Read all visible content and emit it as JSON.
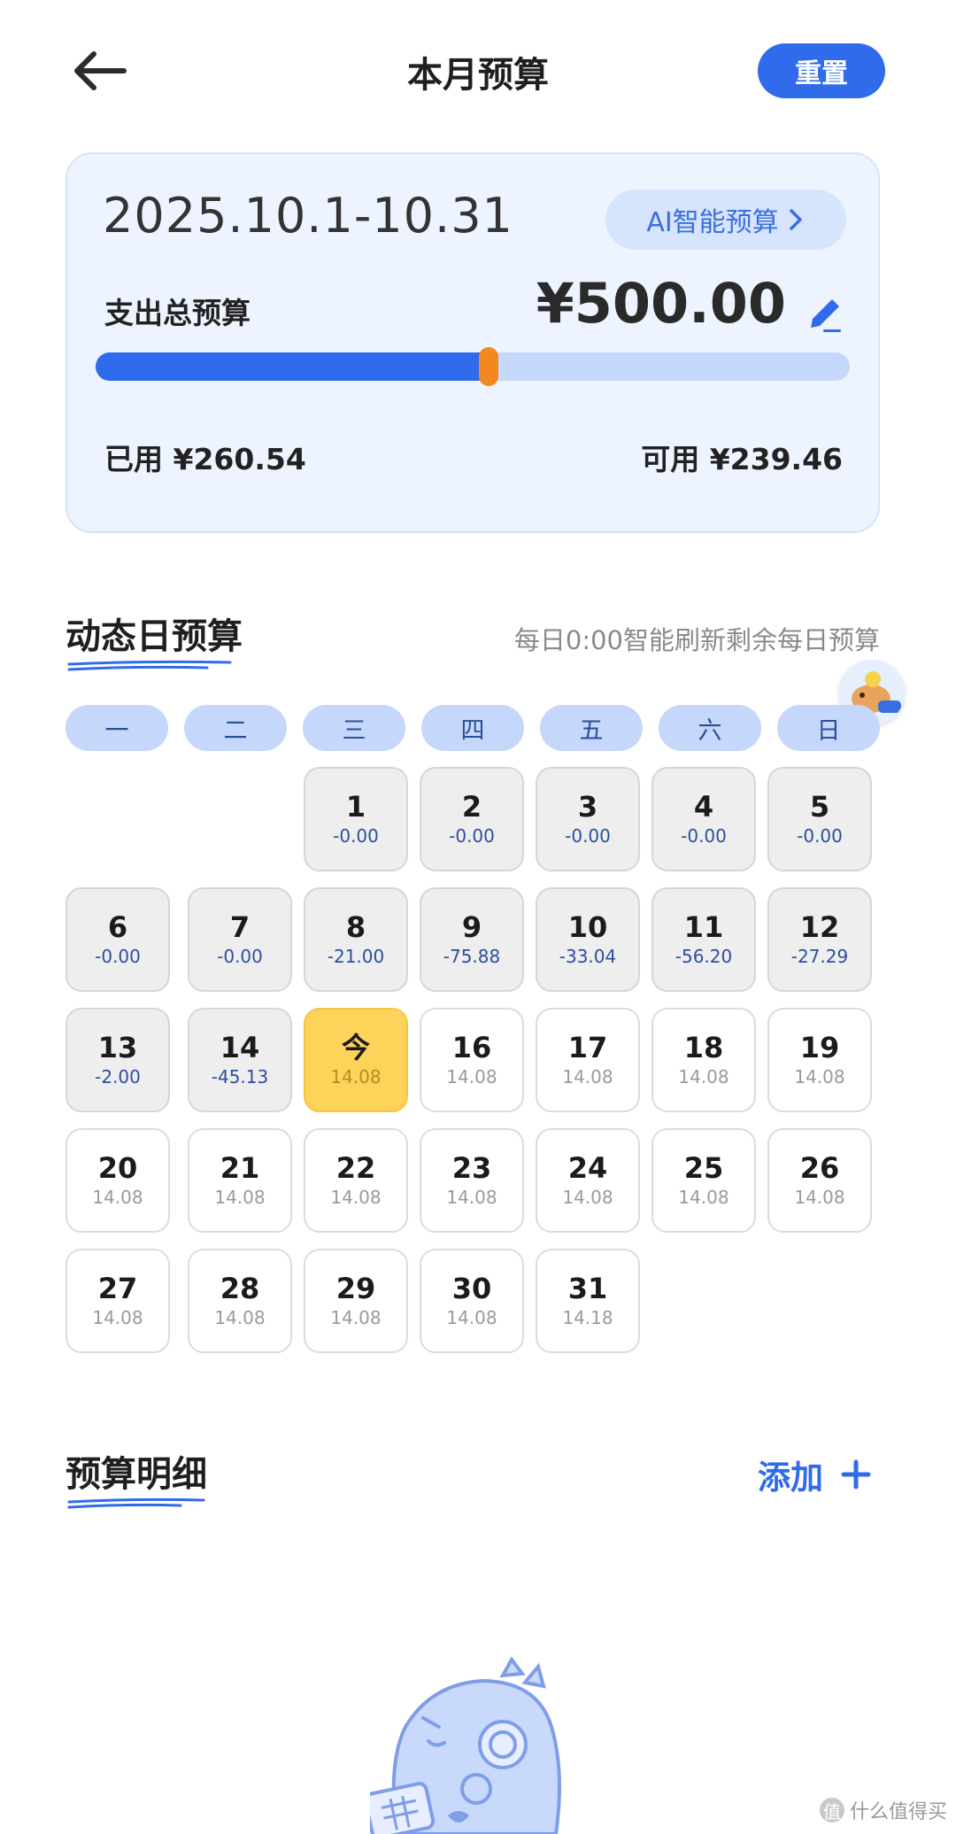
{
  "header": {
    "title": "本月预算",
    "reset_label": "重置"
  },
  "budget": {
    "date_range": "2025.10.1-10.31",
    "ai_button_label": "AI智能预算",
    "total_label": "支出总预算",
    "total_value": "¥500.00",
    "used_text": "已用 ¥260.54",
    "available_text": "可用 ¥239.46",
    "used_fraction": 0.521
  },
  "daily": {
    "title": "动态日预算",
    "note": "每日0:00智能刷新剩余每日预算",
    "weekdays": [
      "一",
      "二",
      "三",
      "四",
      "五",
      "六",
      "日"
    ],
    "days": [
      {
        "day": "1",
        "value": "-0.00",
        "state": "past"
      },
      {
        "day": "2",
        "value": "-0.00",
        "state": "past"
      },
      {
        "day": "3",
        "value": "-0.00",
        "state": "past"
      },
      {
        "day": "4",
        "value": "-0.00",
        "state": "past"
      },
      {
        "day": "5",
        "value": "-0.00",
        "state": "past"
      },
      {
        "day": "6",
        "value": "-0.00",
        "state": "past"
      },
      {
        "day": "7",
        "value": "-0.00",
        "state": "past"
      },
      {
        "day": "8",
        "value": "-21.00",
        "state": "past"
      },
      {
        "day": "9",
        "value": "-75.88",
        "state": "past"
      },
      {
        "day": "10",
        "value": "-33.04",
        "state": "past"
      },
      {
        "day": "11",
        "value": "-56.20",
        "state": "past"
      },
      {
        "day": "12",
        "value": "-27.29",
        "state": "past"
      },
      {
        "day": "13",
        "value": "-2.00",
        "state": "past"
      },
      {
        "day": "14",
        "value": "-45.13",
        "state": "past"
      },
      {
        "day": "今",
        "value": "14.08",
        "state": "today"
      },
      {
        "day": "16",
        "value": "14.08",
        "state": "future"
      },
      {
        "day": "17",
        "value": "14.08",
        "state": "future"
      },
      {
        "day": "18",
        "value": "14.08",
        "state": "future"
      },
      {
        "day": "19",
        "value": "14.08",
        "state": "future"
      },
      {
        "day": "20",
        "value": "14.08",
        "state": "future"
      },
      {
        "day": "21",
        "value": "14.08",
        "state": "future"
      },
      {
        "day": "22",
        "value": "14.08",
        "state": "future"
      },
      {
        "day": "23",
        "value": "14.08",
        "state": "future"
      },
      {
        "day": "24",
        "value": "14.08",
        "state": "future"
      },
      {
        "day": "25",
        "value": "14.08",
        "state": "future"
      },
      {
        "day": "26",
        "value": "14.08",
        "state": "future"
      },
      {
        "day": "27",
        "value": "14.08",
        "state": "future"
      },
      {
        "day": "28",
        "value": "14.08",
        "state": "future"
      },
      {
        "day": "29",
        "value": "14.08",
        "state": "future"
      },
      {
        "day": "30",
        "value": "14.08",
        "state": "future"
      },
      {
        "day": "31",
        "value": "14.18",
        "state": "future"
      }
    ]
  },
  "detail": {
    "title": "预算明细",
    "add_label": "添加"
  },
  "watermark": {
    "badge": "值",
    "text": "什么值得买"
  },
  "icons": {
    "back": "arrow-left-icon",
    "edit": "pencil-icon",
    "chevron": "chevron-right-icon",
    "add": "plus-icon",
    "mascot": "capybara-mascot-icon"
  },
  "colors": {
    "primary": "#2f6bea",
    "card_bg": "#eef4ff",
    "progress_track": "#c5d7fb",
    "progress_handle": "#f2881e",
    "today": "#fdd35a",
    "past_cell": "#eeeeee"
  }
}
